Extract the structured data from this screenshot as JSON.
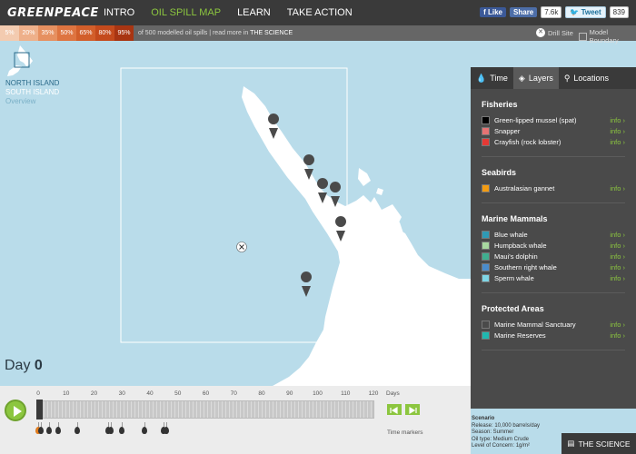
{
  "nav": {
    "logo": "GREENPEACE",
    "links": [
      "INTRO",
      "OIL SPILL MAP",
      "LEARN",
      "TAKE ACTION"
    ],
    "active": "OIL SPILL MAP"
  },
  "social": {
    "fb_like": "Like",
    "fb_share": "Share",
    "fb_count": "7.6k",
    "tweet": "Tweet",
    "tweet_count": "839"
  },
  "probability": {
    "cells": [
      {
        "label": "5%",
        "color": "#f3cbb0"
      },
      {
        "label": "20%",
        "color": "#eeb08a"
      },
      {
        "label": "35%",
        "color": "#e69060"
      },
      {
        "label": "50%",
        "color": "#de7440"
      },
      {
        "label": "65%",
        "color": "#d25e2a"
      },
      {
        "label": "80%",
        "color": "#c44a1c"
      },
      {
        "label": "95%",
        "color": "#a83512"
      }
    ],
    "text_main": "of 500 modelled oil spills | read more in",
    "text_link": "THE SCIENCE",
    "drill_site": "Drill Site",
    "model_boundary": "Model Boundary"
  },
  "islands": {
    "north": "NORTH ISLAND",
    "south": "SOUTH ISLAND",
    "overview": "Overview"
  },
  "day": {
    "label": "Day",
    "value": "0"
  },
  "panel": {
    "tabs": [
      {
        "label": "Time",
        "icon": "drop-icon"
      },
      {
        "label": "Layers",
        "icon": "layers-icon"
      },
      {
        "label": "Locations",
        "icon": "pin-icon"
      }
    ],
    "active_tab": "Layers",
    "info_label": "info",
    "sections": [
      {
        "title": "Fisheries",
        "items": [
          {
            "label": "Green-lipped mussel (spat)",
            "color": "#000000"
          },
          {
            "label": "Snapper",
            "color": "#e57373"
          },
          {
            "label": "Crayfish (rock lobster)",
            "color": "#e53935"
          }
        ]
      },
      {
        "title": "Seabirds",
        "items": [
          {
            "label": "Australasian gannet",
            "color": "#f39c12"
          }
        ]
      },
      {
        "title": "Marine Mammals",
        "items": [
          {
            "label": "Blue whale",
            "color": "#2e9ab5"
          },
          {
            "label": "Humpback whale",
            "color": "#a8d8a0"
          },
          {
            "label": "Maui's dolphin",
            "color": "#3fae8f"
          },
          {
            "label": "Southern right whale",
            "color": "#4a8ccc"
          },
          {
            "label": "Sperm whale",
            "color": "#7fd6e6"
          }
        ]
      },
      {
        "title": "Protected Areas",
        "items": [
          {
            "label": "Marine Mammal Sanctuary",
            "color": "#4a4a4a"
          },
          {
            "label": "Marine Reserves",
            "color": "#20b8b0"
          }
        ]
      }
    ]
  },
  "timeline": {
    "ticks": [
      "0",
      "10",
      "20",
      "30",
      "40",
      "50",
      "60",
      "70",
      "80",
      "90",
      "100",
      "110",
      "120"
    ],
    "days_label": "Days",
    "markers_label": "Time markers",
    "marker_days": [
      0,
      1,
      4,
      7,
      14,
      25,
      26,
      30,
      38,
      45,
      46
    ]
  },
  "scenario": {
    "title": "Scenario",
    "lines": [
      "Release: 10,000 barrels/day",
      "Season: Summer",
      "Oil type: Medium Crude",
      "Level of Concern: 1g/m²"
    ]
  },
  "science_button": "THE SCIENCE"
}
